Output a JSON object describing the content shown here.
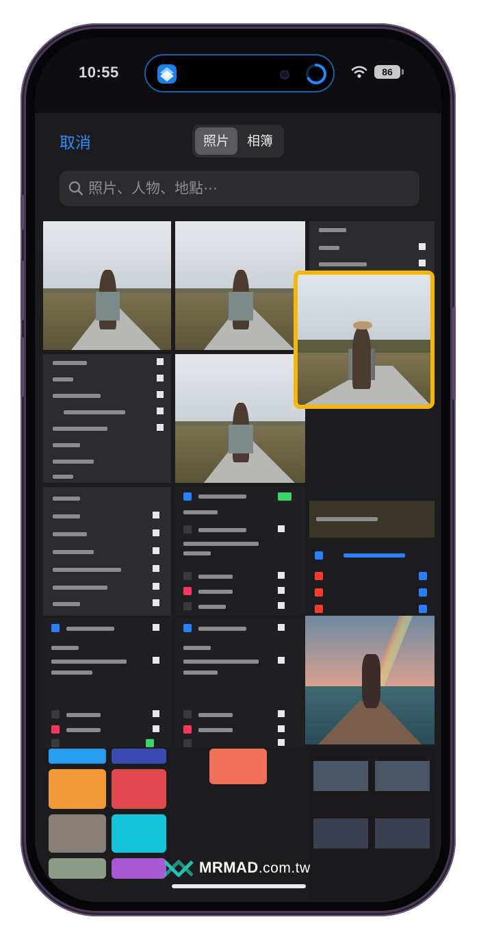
{
  "status_bar": {
    "time": "10:55",
    "battery": "86",
    "wifi_icon": "wifi-icon",
    "app_icon": "shortcuts-icon"
  },
  "picker": {
    "cancel_label": "取消",
    "tabs": [
      {
        "label": "照片",
        "active": true
      },
      {
        "label": "相簿",
        "active": false
      }
    ],
    "search": {
      "placeholder": "照片、人物、地點⋯",
      "value": ""
    }
  },
  "watermark": {
    "brand": "MRMAD",
    "suffix": ".com.tw",
    "logo_icon": "mrmad-logo-icon"
  },
  "colors": {
    "accent": "#2f8bff",
    "selection": "#f5b800",
    "sheet_bg": "#1c1c1e"
  }
}
